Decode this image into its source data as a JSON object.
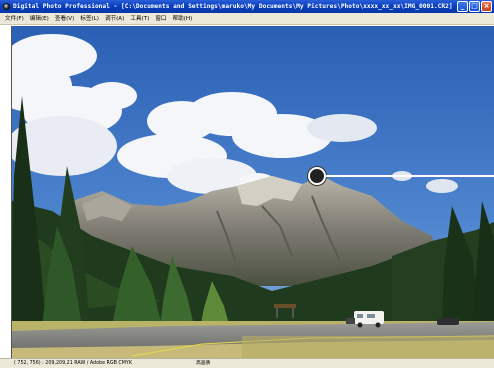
{
  "window": {
    "title": "Digital Photo Professional - [C:\\Documents and Settings\\maruko\\My Documents\\My Pictures\\Photo\\xxxx_xx_xx\\IMG_0001.CR2]",
    "minimize_glyph": "_",
    "maximize_glyph": "□",
    "close_glyph": "×"
  },
  "menu": {
    "items": [
      {
        "label": "文件(F)"
      },
      {
        "label": "编辑(E)"
      },
      {
        "label": "查看(V)"
      },
      {
        "label": "标签(L)"
      },
      {
        "label": "调节(A)"
      },
      {
        "label": "工具(T)"
      },
      {
        "label": "窗口"
      },
      {
        "label": "帮助(H)"
      }
    ]
  },
  "status": {
    "info": "( 752,  756) : 209,209,21 RAW / Adobe RGB  CMYK",
    "quality": "高画质"
  },
  "icons": {
    "app": "app-icon",
    "cursor": "pointer-marker-icon"
  },
  "colors": {
    "titlebar": "#0a3fbf",
    "menubar": "#ece9d8",
    "sky": "#3a6fc0"
  }
}
